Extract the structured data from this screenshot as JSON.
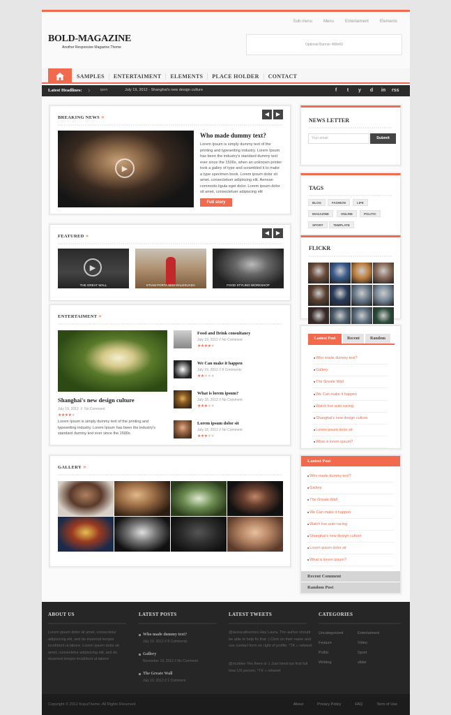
{
  "top_nav": [
    "Sub menu",
    "Menu",
    "Entertaiment",
    "Elements"
  ],
  "logo": "BOLD-MAGAZINE",
  "tagline": "Another Responsive Magazine Theme",
  "banner": "Optional Banner 468x60",
  "main_nav": [
    "SAMPLES",
    "ENTERTAIMENT",
    "ELEMENTS",
    "PLACE HOLDER",
    "CONTACT"
  ],
  "headline": {
    "label": "Latest Headlines:",
    "item1": "ipen",
    "item2": "July 19, 2012 - Shanghai's new design culture"
  },
  "social": [
    "f",
    "t",
    "y",
    "d",
    "in",
    "rss"
  ],
  "breaking": {
    "title": "BREAKING NEWS",
    "post_title": "Who made dummy text?",
    "text": "Lorem Ipsum is simply dummy text of the printing and typesetting industry. Lorem Ipsum has been the industry's standard dummy text ever since the 1500s, when an unknown printer took a galley of type and scrambled it to make a type specimen book. Lorem ipsum dolor sit amet, consectetuer adipiscing elit. Aenean commodo ligula eget dolor. Lorem ipsum dolor sit amet, consectetuer adipiscing elit",
    "button": "Full story"
  },
  "featured": {
    "title": "FEATURED",
    "items": [
      "THE GREAT WALL",
      "ETIAM PORTA SEM MALESUADA",
      "FOOD STYLING WORKSHOP"
    ]
  },
  "ent": {
    "title": "ENTERTAIMENT",
    "main_title": "Shanghai's new design culture",
    "main_date": "July 19, 2012",
    "main_comment": "No Comment",
    "main_text": "Lorem Ipsum is simply dummy text of the printing and typesetting industry. Lorem Ipsum has been the industry's standard dummy text ever since the 1500s.",
    "list": [
      {
        "t": "Food and Drink consultancy",
        "d": "July 19, 2012",
        "c": "No Comment",
        "r": 4
      },
      {
        "t": "We Can make it happen",
        "d": "July 19, 2012",
        "c": "8 Comments",
        "r": 2
      },
      {
        "t": "What is lorem ipsum?",
        "d": "July 18, 2012",
        "c": "No Comment",
        "r": 3
      },
      {
        "t": "Lorem ipsum dolor sit",
        "d": "July 18, 2012",
        "c": "No Comment",
        "r": 3
      }
    ]
  },
  "gallery": {
    "title": "GALLERY"
  },
  "newsletter": {
    "title": "NEWS LETTER",
    "placeholder": "Your email",
    "button": "Submit"
  },
  "tags": {
    "title": "TAGS",
    "items": [
      "BLOG",
      "FASHION",
      "LIFE",
      "MAGAZINE",
      "ONLINE",
      "POLITIC",
      "SPORT",
      "TEMPLATE"
    ]
  },
  "flickr": {
    "title": "FLICKR"
  },
  "tabs": {
    "labels": [
      "Lastest Post",
      "Recent",
      "Random"
    ],
    "items": [
      "Who made dummy text?",
      "Gallery",
      "The Greate Wall",
      "We Can make it happen",
      "Watch live auto racing",
      "Shanghai's new design culture",
      "Lorem ipsum dolor sit",
      "What is lorem ipsum?"
    ]
  },
  "accordion": {
    "title": "Lastest Post",
    "items": [
      "Who made dummy text?",
      "Gallery",
      "The Greate Wall",
      "We Can make it happen",
      "Watch live auto racing",
      "Shanghai's new design culture",
      "Lorem ipsum dolor sit",
      "What is lorem ipsum?"
    ],
    "recent_comment": "Recent Comment",
    "random_post": "Random Post"
  },
  "footer": {
    "about_title": "ABOUT US",
    "about_text": "Lorem ipsum dolor sit amet, consectetur adipisicing elit, sed do eiusmod tempor incididunt ut labore. Lorem ipsum dolor sit amet, consectetur adipisicing elit, sed do eiusmod tempor incididunt ut labore",
    "posts_title": "LATEST POSTS",
    "posts": [
      {
        "t": "Who made dummy text?",
        "d": "July 19, 2012",
        "c": "8 Comments"
      },
      {
        "t": "Gallery",
        "d": "November 19, 2012",
        "c": "No Comment"
      },
      {
        "t": "The Greate Wall",
        "d": "July 19, 2012",
        "c": "1 Comment"
      }
    ],
    "tweets_title": "LATEST TWEETS",
    "tweet1": "@lauracatherines Hey Laura. The author should be able to help fix that :) Click on their name and use contact form on right of profile. *TK » retweet",
    "tweet2": "@ricoblev Yes there is :) Just hired our first full time UX person. *TK » retweet",
    "cat_title": "CATEGORIES",
    "cats": [
      "Uncategorized",
      "Entertaiment",
      "Feature",
      "Video",
      "Politic",
      "Sport",
      "Writting",
      "slider"
    ]
  },
  "bottom": {
    "copy": "Copyright © 2012 KopaTheme. All Rights Reserved",
    "links": [
      "About",
      "Privacy Policy",
      "FAQ",
      "Term of Use"
    ]
  }
}
